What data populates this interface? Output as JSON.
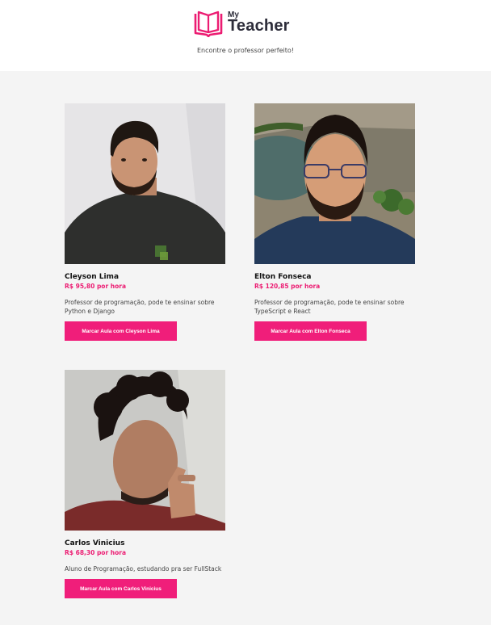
{
  "header": {
    "logo_small": "My",
    "logo_big": "Teacher",
    "tagline": "Encontre o professor perfeito!"
  },
  "colors": {
    "accent": "#f01e7a",
    "price": "#ec1c72",
    "background": "#f4f4f4"
  },
  "teachers": [
    {
      "name": "Cleyson Lima",
      "price": "R$ 95,80 por hora",
      "bio": "Professor de programação, pode te ensinar sobre Python e Django",
      "button": "Marcar Aula com Cleyson Lima"
    },
    {
      "name": "Elton Fonseca",
      "price": "R$ 120,85 por hora",
      "bio": "Professor de programação, pode te ensinar sobre TypeScript e React",
      "button": "Marcar Aula com Elton Fonseca"
    },
    {
      "name": "Carlos Vinicius",
      "price": "R$ 68,30 por hora",
      "bio": "Aluno de Programação, estudando pra ser FullStack",
      "button": "Marcar Aula com Carlos Vinicius"
    }
  ]
}
